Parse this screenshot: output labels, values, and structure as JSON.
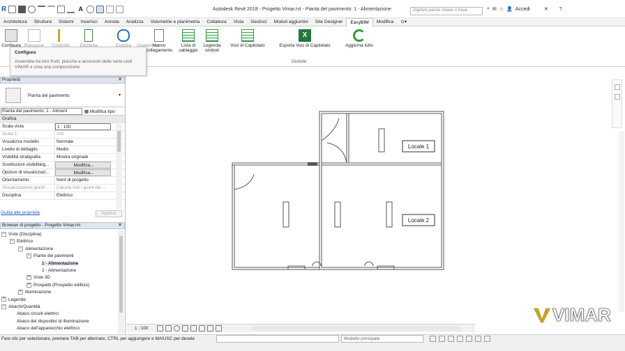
{
  "app": {
    "title": "Autodesk Revit 2018 -   Progetto Vimar.rvt - Pianta del pavimento: 1 - Alimentazione",
    "search_placeholder": "Digitare parola chiave o frase",
    "signin_label": "Accedi",
    "help_label": "?"
  },
  "tabs": [
    "Architettura",
    "Struttura",
    "Sistemi",
    "Inserisci",
    "Annota",
    "Analizza",
    "Volumetrie e planimetria",
    "Collabora",
    "Vista",
    "Gestisci",
    "Moduli aggiuntivi",
    "Site Designer",
    "EasyBIM",
    "Modifica"
  ],
  "active_tab": "EasyBIM",
  "ribbon": {
    "buttons": [
      {
        "label": "Configura"
      },
      {
        "label": "Riassume"
      },
      {
        "label": "Controllo"
      },
      {
        "label": "Etichetta"
      },
      {
        "label": "Esplora"
      },
      {
        "label": "Quotazione"
      },
      {
        "label": "Nuovo collegamento"
      },
      {
        "label": "Lista di cablaggio"
      },
      {
        "label": "Legenda simboli"
      },
      {
        "label": "Voci di Capitolato"
      },
      {
        "label": "Esporta Voci di Capitolato"
      },
      {
        "label": "Aggiorna tutto"
      }
    ],
    "panel_label": "Distinte"
  },
  "tooltip": {
    "title": "Configura",
    "description": "Assembla tra loro frutti, placche e accessori delle serie civili VIMAR e crea una composizione"
  },
  "properties": {
    "header": "Proprietà",
    "type_name": "Pianta del pavimento",
    "selector": "Pianta del pavimento: 1 - Aliment",
    "edit_type": "Modifica tipo",
    "category": "Grafica",
    "rows": [
      {
        "k": "Scala vista",
        "v": "1 : 100",
        "style": "input"
      },
      {
        "k": "Scala 1:",
        "v": "100",
        "style": "dis"
      },
      {
        "k": "Visualizza modello",
        "v": "Normale"
      },
      {
        "k": "Livello di dettaglio",
        "v": "Medio"
      },
      {
        "k": "Visibilità stratigrafia",
        "v": "Mostra originale"
      },
      {
        "k": "Sostituzioni visibilità/g...",
        "v": "Modifica...",
        "style": "btn"
      },
      {
        "k": "Opzioni di visualizzazi...",
        "v": "Modifica...",
        "style": "btn"
      },
      {
        "k": "Orientamento",
        "v": "Nord di progetto"
      },
      {
        "k": "Visualizzazione giunti ...",
        "v": "Calcola tutti i giunti dei ...",
        "style": "dis"
      },
      {
        "k": "Disciplina",
        "v": "Elettrico"
      }
    ],
    "help_link": "Guida alle proprietà",
    "apply_label": "Applica"
  },
  "browser": {
    "header": "Browser di progetto - Progetto Vimar.rvt",
    "items": [
      {
        "label": "Viste (Disciplina)",
        "level": 0,
        "toggle": "−"
      },
      {
        "label": "Elettrico",
        "level": 1,
        "toggle": "−"
      },
      {
        "label": "Alimentazione",
        "level": 2,
        "toggle": "−"
      },
      {
        "label": "Piante dei pavimenti",
        "level": 3,
        "toggle": "−"
      },
      {
        "label": "1 - Alimentazione",
        "level": 4,
        "toggle": "",
        "bold": true
      },
      {
        "label": "2 - Alimentazione",
        "level": 4,
        "toggle": ""
      },
      {
        "label": "Viste 3D",
        "level": 3,
        "toggle": "+"
      },
      {
        "label": "Prospetti (Prospetto edificio)",
        "level": 3,
        "toggle": "+"
      },
      {
        "label": "Illuminazione",
        "level": 2,
        "toggle": "+"
      },
      {
        "label": "Legende",
        "level": 0,
        "toggle": "+"
      },
      {
        "label": "Abachi/Quantità",
        "level": 0,
        "toggle": "−"
      },
      {
        "label": "Abaco circuiti elettrici",
        "level": 1,
        "toggle": ""
      },
      {
        "label": "Abaco dei dispositivi di illuminazione",
        "level": 1,
        "toggle": ""
      },
      {
        "label": "Abaco dell'apparecchio elettrico",
        "level": 1,
        "toggle": ""
      }
    ]
  },
  "canvas": {
    "rooms": [
      {
        "label": "Locale 1"
      },
      {
        "label": "Locale 2"
      }
    ]
  },
  "viewbar": {
    "scale": "1 : 100"
  },
  "status": {
    "text": "Fare clic per selezionare, premere TAB per alternare, CTRL per aggiungere e MAIUSC per desele",
    "model": "Modello principale"
  },
  "logo": {
    "text": "VIMAR"
  },
  "colors": {
    "accent": "#2b6cb0",
    "easybim_green": "#2e9b3c",
    "tab_active": "#ffffff"
  }
}
